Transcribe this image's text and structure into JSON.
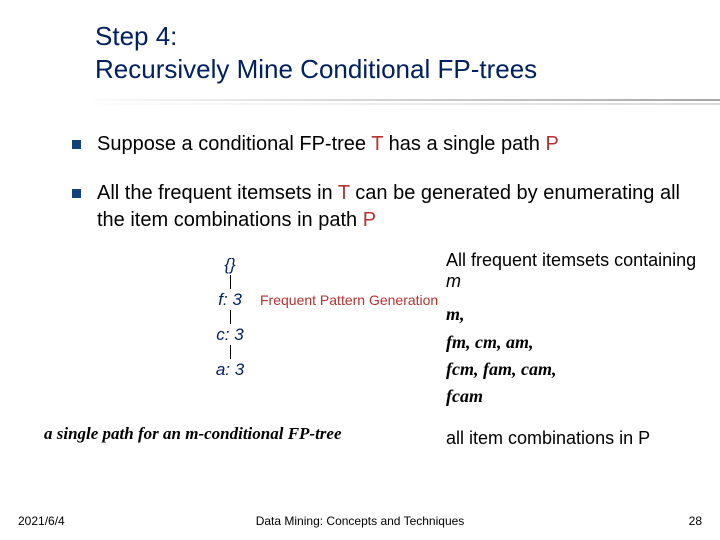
{
  "title": {
    "line1": "Step 4:",
    "line2": "Recursively Mine Conditional FP-trees"
  },
  "bullets": [
    {
      "pre": "Suppose a conditional FP-tree ",
      "t": "T",
      "mid": " has a single path ",
      "p": "P"
    },
    {
      "pre": "All the frequent itemsets in ",
      "t": "T",
      "mid": " can be generated by enumerating all the item combinations in path ",
      "p": "P"
    }
  ],
  "path": {
    "root": "{}",
    "n1": "f: 3",
    "n2": "c: 3",
    "n3": "a: 3"
  },
  "fpg_label": "Frequent Pattern Generation",
  "right": {
    "heading_pre": "All frequent itemsets containing ",
    "heading_var": "m",
    "rows": [
      "m,",
      "fm, cm, am,",
      "fcm, fam, cam,",
      "fcam"
    ]
  },
  "single_path_caption": "a single path for an m-conditional FP-tree",
  "all_comb": "all item combinations in P",
  "footer": {
    "date": "2021/6/4",
    "center": "Data Mining: Concepts and Techniques",
    "page": "28"
  }
}
